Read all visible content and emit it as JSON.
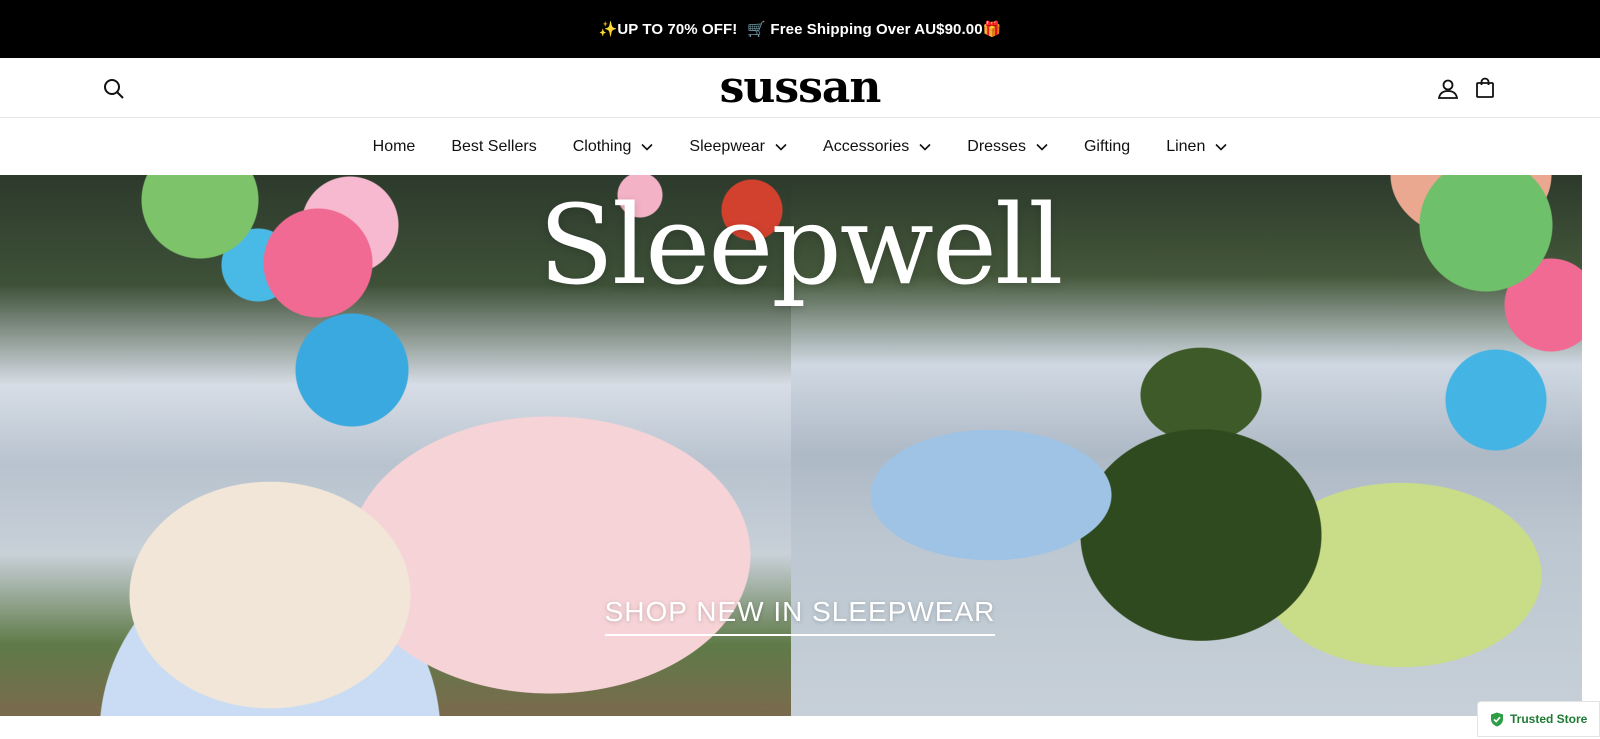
{
  "announcement": {
    "part1": "✨UP TO 70% OFF!",
    "part2": "🛒 Free Shipping Over AU$90.00🎁"
  },
  "header": {
    "logo": "sussan",
    "icons": [
      "search-icon",
      "account-icon",
      "cart-icon"
    ]
  },
  "nav": {
    "items": [
      {
        "label": "Home",
        "dropdown": false
      },
      {
        "label": "Best Sellers",
        "dropdown": false
      },
      {
        "label": "Clothing",
        "dropdown": true
      },
      {
        "label": "Sleepwear",
        "dropdown": true
      },
      {
        "label": "Accessories",
        "dropdown": true
      },
      {
        "label": "Dresses",
        "dropdown": true
      },
      {
        "label": "Gifting",
        "dropdown": false
      },
      {
        "label": "Linen",
        "dropdown": true
      }
    ]
  },
  "hero": {
    "title": "Sleepwell",
    "cta": "SHOP NEW IN SLEEPWEAR"
  },
  "badge": {
    "label": "Trusted Store",
    "color": "#1e7a34"
  }
}
